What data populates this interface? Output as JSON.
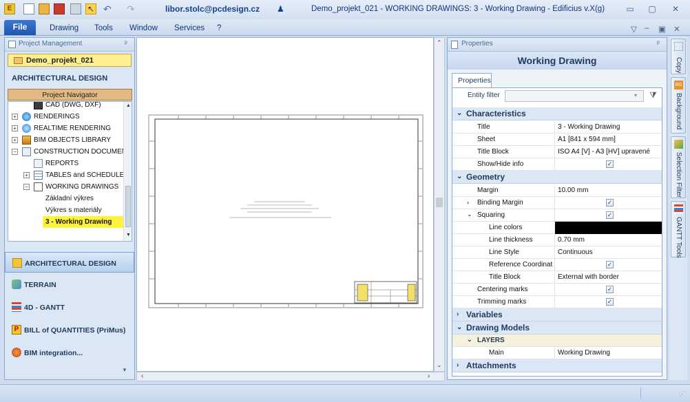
{
  "titlebar": {
    "user": "libor.stolc@pcdesign.cz",
    "window_title": "Demo_projekt_021  -  WORKING DRAWINGS: 3 - Working Drawing - Edificius v.X(g)",
    "min": "▭",
    "max": "▢",
    "close": "✕"
  },
  "menubar": {
    "file": "File",
    "items": [
      "Drawing",
      "Tools",
      "Window",
      "Services",
      "?"
    ]
  },
  "project_management": {
    "title": "Project Management",
    "project": "Demo_projekt_021",
    "section": "ARCHITECTURAL DESIGN",
    "navigator": "Project Navigator",
    "tree": [
      "CAD (DWG, DXF)",
      "RENDERINGS",
      "REALTIME RENDERING",
      "BIM OBJECTS LIBRARY",
      "CONSTRUCTION DOCUMENTS",
      "REPORTS",
      "TABLES and SCHEDULES",
      "WORKING DRAWINGS",
      "Základní výkres",
      "Výkres s materiály",
      "3 - Working Drawing"
    ],
    "modules": [
      "ARCHITECTURAL DESIGN",
      "TERRAIN",
      "4D - GANTT",
      "BILL of QUANTITIES (PriMus)",
      "BIM integration..."
    ]
  },
  "properties": {
    "pane_title": "Properties",
    "header": "Working Drawing",
    "tab": "Properties",
    "entity_filter_label": "Entity filter",
    "characteristics": {
      "title": "Characteristics",
      "rows": [
        {
          "name": "Title",
          "value": "3 - Working Drawing"
        },
        {
          "name": "Sheet",
          "value": "A1 [841 x 594 mm]"
        },
        {
          "name": "Title Block",
          "value": "ISO  A4 [V] - A3 [HV] upravené"
        },
        {
          "name": "Show/Hide info",
          "value": "✓"
        }
      ]
    },
    "geometry": {
      "title": "Geometry",
      "rows": [
        {
          "name": "Margin",
          "value": "10.00 mm"
        },
        {
          "name": "Binding Margin",
          "value": "✓"
        },
        {
          "name": "Squaring",
          "value": "✓"
        },
        {
          "name": "Line colors",
          "value": ""
        },
        {
          "name": "Line thickness",
          "value": "0.70 mm"
        },
        {
          "name": "Line Style",
          "value": "Continuous"
        },
        {
          "name": "Reference Coordinat",
          "value": "✓"
        },
        {
          "name": "Title Block",
          "value": "External with border"
        },
        {
          "name": "Centering marks",
          "value": "✓"
        },
        {
          "name": "Trimming marks",
          "value": "✓"
        }
      ]
    },
    "variables": "Variables",
    "drawing_models": {
      "title": "Drawing Models",
      "layers": "LAYERS",
      "rows": [
        {
          "name": "Main",
          "value": "Working Drawing"
        }
      ]
    },
    "attachments": "Attachments",
    "line_color": "#000000"
  },
  "right_tabs": [
    "Copy",
    "Background",
    "Selection Filter",
    "GANTT Tools"
  ],
  "colors": {
    "accent": "#1f55ad",
    "project_highlight": "#ffef8f",
    "selected_item": "#fff23a",
    "navigator": "#e2b983"
  }
}
